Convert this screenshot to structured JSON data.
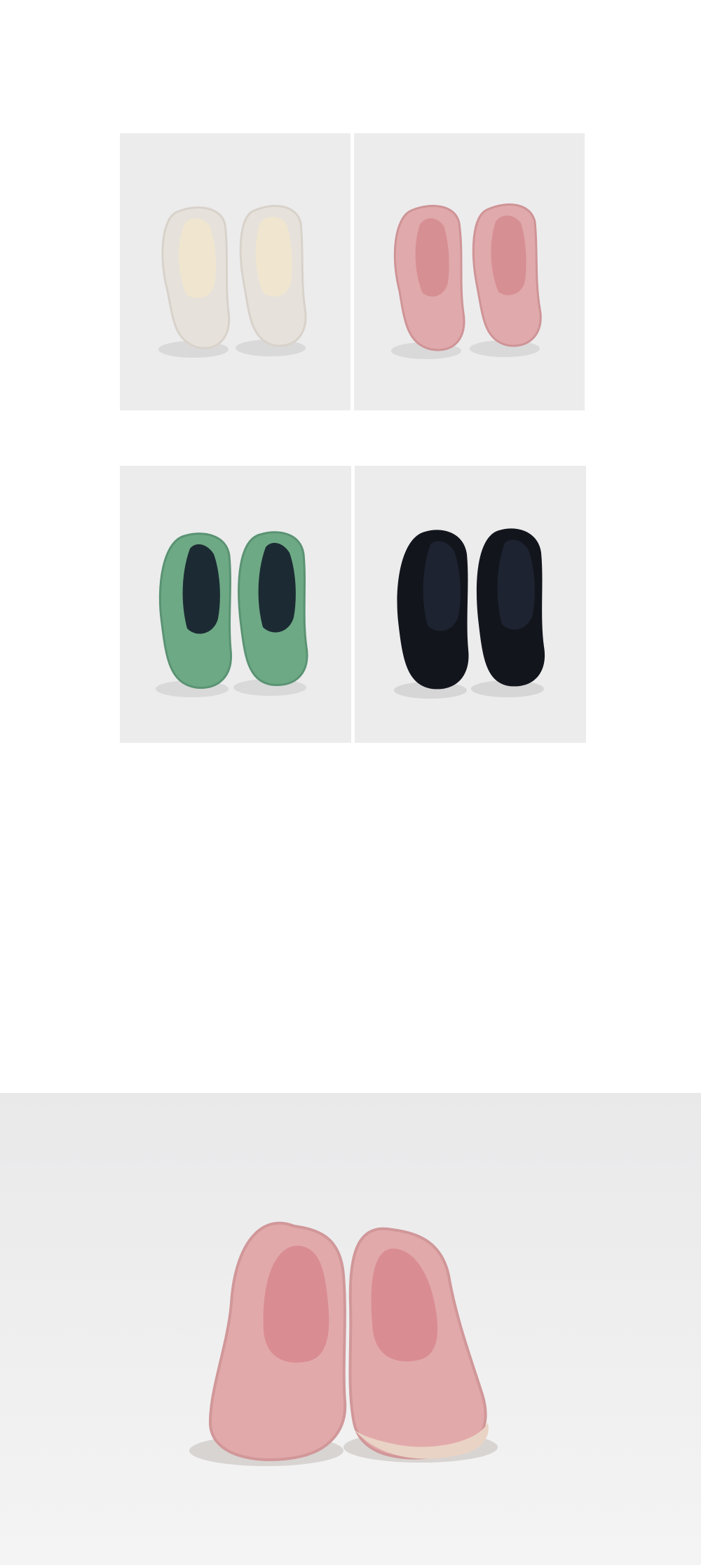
{
  "swatch_grid": {
    "tiles": [
      {
        "color_name": "ivory",
        "fur": "#e8e3dc",
        "inner": "#f1ead9",
        "shade": "#d6d0c7"
      },
      {
        "color_name": "pink",
        "fur": "#e0a9ab",
        "inner": "#d68f93",
        "shade": "#c98c90"
      },
      {
        "color_name": "green",
        "fur": "#6ea985",
        "inner": "#1c2b33",
        "shade": "#5a9373"
      },
      {
        "color_name": "black",
        "fur": "#12151c",
        "inner": "#1d2330",
        "shade": "#06080c"
      }
    ]
  },
  "hero": {
    "color_name": "pink",
    "fur": "#e2a9ab",
    "inner": "#d98d93",
    "sole": "#e9d3c5"
  }
}
